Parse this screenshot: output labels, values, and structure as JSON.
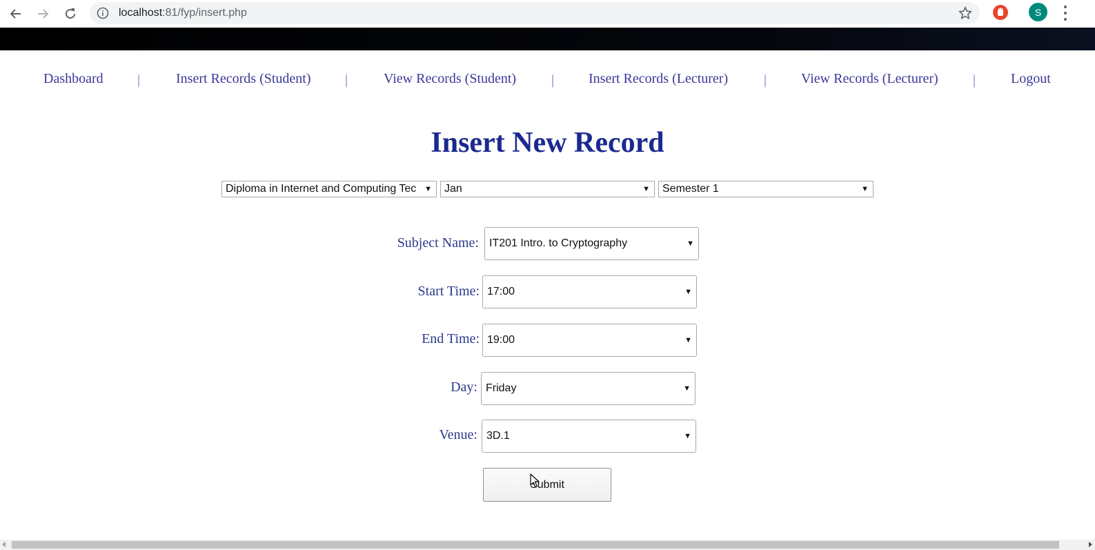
{
  "browser": {
    "url_host": "localhost",
    "url_rest": ":81/fyp/insert.php",
    "avatar_letter": "S",
    "accent_avatar": "#00897b"
  },
  "nav": {
    "items": [
      {
        "label": "Dashboard"
      },
      {
        "label": "Insert Records (Student)"
      },
      {
        "label": "View Records (Student)"
      },
      {
        "label": "Insert Records (Lecturer)"
      },
      {
        "label": "View Records (Lecturer)"
      },
      {
        "label": "Logout"
      }
    ],
    "separator": "|",
    "color": "#3a3799"
  },
  "page": {
    "title": "Insert New Record",
    "title_color": "#1b2a8f"
  },
  "filters": {
    "course": "Diploma in Internet and Computing Tec",
    "month": "Jan",
    "semester": "Semester 1"
  },
  "form": {
    "subject": {
      "label": "Subject Name:",
      "value": "IT201 Intro. to Cryptography"
    },
    "start_time": {
      "label": "Start Time:",
      "value": "17:00"
    },
    "end_time": {
      "label": "End Time:",
      "value": "19:00"
    },
    "day": {
      "label": "Day:",
      "value": "Friday"
    },
    "venue": {
      "label": "Venue:",
      "value": "3D.1"
    },
    "submit_label": "Submit"
  }
}
